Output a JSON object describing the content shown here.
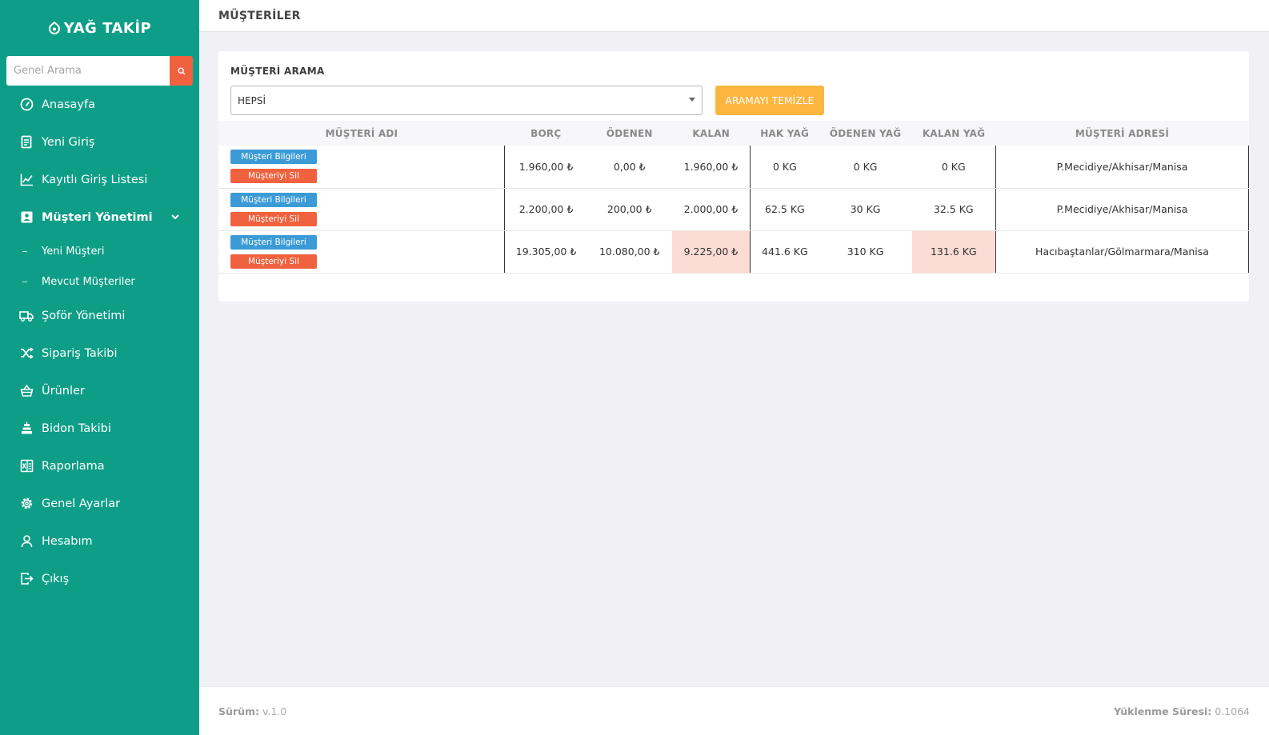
{
  "app": {
    "title": "YAĞ TAKİP"
  },
  "search": {
    "placeholder": "Genel Arama"
  },
  "sidebar": {
    "items": [
      {
        "label": "Anasayfa",
        "icon": "dashboard-icon"
      },
      {
        "label": "Yeni Giriş",
        "icon": "document-icon"
      },
      {
        "label": "Kayıtlı Giriş Listesi",
        "icon": "chart-line-icon"
      },
      {
        "label": "Müşteri Yönetimi",
        "icon": "user-card-icon"
      },
      {
        "label": "Şoför Yönetimi",
        "icon": "truck-icon"
      },
      {
        "label": "Sipariş Takibi",
        "icon": "shuffle-icon"
      },
      {
        "label": "Ürünler",
        "icon": "basket-icon"
      },
      {
        "label": "Bidon Takibi",
        "icon": "stack-icon"
      },
      {
        "label": "Raporlama",
        "icon": "excel-icon"
      },
      {
        "label": "Genel Ayarlar",
        "icon": "gear-icon"
      },
      {
        "label": "Hesabım",
        "icon": "user-icon"
      },
      {
        "label": "Çıkış",
        "icon": "logout-icon"
      }
    ],
    "sub_items": [
      {
        "label": "Yeni Müşteri"
      },
      {
        "label": "Mevcut Müşteriler"
      }
    ]
  },
  "header": {
    "title": "MÜŞTERİLER"
  },
  "filter": {
    "label": "MÜŞTERİ ARAMA",
    "selected": "HEPSİ",
    "clear_label": "ARAMAYI TEMİZLE"
  },
  "table": {
    "columns": [
      "MÜŞTERİ ADI",
      "BORÇ",
      "ÖDENEN",
      "KALAN",
      "HAK YAĞ",
      "ÖDENEN YAĞ",
      "KALAN YAĞ",
      "MÜŞTERİ ADRESİ"
    ],
    "info_label": "Müşteri Bilgileri",
    "delete_label": "Müşteriyi Sil",
    "rows": [
      {
        "borc": "1.960,00 ₺",
        "odenen": "0,00 ₺",
        "kalan": "1.960,00 ₺",
        "hak_yag": "0 KG",
        "odenen_yag": "0 KG",
        "kalan_yag": "0 KG",
        "adres": "P.Mecidiye/Akhisar/Manisa"
      },
      {
        "borc": "2.200,00 ₺",
        "odenen": "200,00 ₺",
        "kalan": "2.000,00 ₺",
        "hak_yag": "62.5 KG",
        "odenen_yag": "30 KG",
        "kalan_yag": "32.5 KG",
        "adres": "P.Mecidiye/Akhisar/Manisa"
      },
      {
        "borc": "19.305,00 ₺",
        "odenen": "10.080,00 ₺",
        "kalan": "9.225,00 ₺",
        "hak_yag": "441.6 KG",
        "odenen_yag": "310 KG",
        "kalan_yag": "131.6 KG",
        "adres": "Hacıbaştanlar/Gölmarmara/Manisa"
      }
    ]
  },
  "footer": {
    "version_label": "Sürüm:",
    "version": "v.1.0",
    "load_label": "Yüklenme Süresi:",
    "load_time": "0.1064"
  },
  "colors": {
    "sidebar": "#0e9e88",
    "danger": "#f0623f",
    "info": "#3c9bd6",
    "warning": "#fcb640",
    "highlight": "#fcdcd4"
  }
}
